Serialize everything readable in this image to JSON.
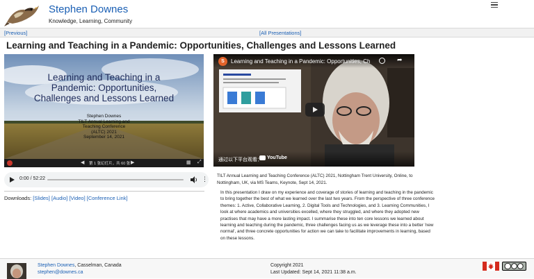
{
  "header": {
    "site_title": "Stephen Downes",
    "tagline": "Knowledge, Learning, Community"
  },
  "nav": {
    "previous": "[Previous]",
    "all_presentations": "[All Presentations]"
  },
  "page_title": "Learning and Teaching in a Pandemic: Opportunities, Challenges and Lessons Learned",
  "slides": {
    "title_lines": [
      "Learning and Teaching in a",
      "Pandemic: Opportunities,",
      "Challenges and Lessons Learned"
    ],
    "author_lines": [
      "Stephen Downes",
      "TILT Annual Learning and",
      "Teaching Conference",
      "(ALTC) 2021",
      "September 14, 2021"
    ],
    "page_indicator": "第 1 张幻灯片，共 60 张"
  },
  "audio": {
    "time": "0:00 / 52:22"
  },
  "downloads": {
    "label": "Downloads:",
    "slides": "[Slides]",
    "audio": "[Audio]",
    "video": "[Video]",
    "conference": "[Conference Link]"
  },
  "video": {
    "channel_initial": "S",
    "title": "Learning and Teaching in a Pandemic: Opportunities, Challen...",
    "watch_label": "通过以下平台观看：",
    "youtube": "YouTube"
  },
  "conference_info": "TILT Annual Learning and Teaching Conference (ALTC) 2021, Nottingham Trent University, Online, to Nottingham, UK, via MS Teams, Keynote, Sept 14, 2021.",
  "abstract": "In this presentation I draw on my experience and coverage of stories of learning and teaching in the pandemic to bring together the best of what we learned over the last two years. From the perspective of three conference themes: 1. Active, Collaborative Learning, 2. Digital Tools and Technologies, and 3. Learning Communities, I look at where academics and universities excelled, where they struggled, and where they adopted new practises that may have a more lasting impact. I summarise these into ten core lessons we learned about learning and teaching during the pandemic, three challenges facing us as we leverage these into a better 'new normal', and three concrete opportunities for action we can take to facilitate improvements in learning, based on these lessons.",
  "footer": {
    "name": "Stephen Downes",
    "location": ", Casselman, Canada",
    "email": "stephen@downes.ca",
    "copyright": "Copyright 2021",
    "updated": "Last Updated: Sept 14, 2021 11:38 a.m."
  },
  "colors": {
    "link": "#1a5fb4",
    "youtube_red": "#ff0000",
    "flag_red": "#d52b1e"
  }
}
